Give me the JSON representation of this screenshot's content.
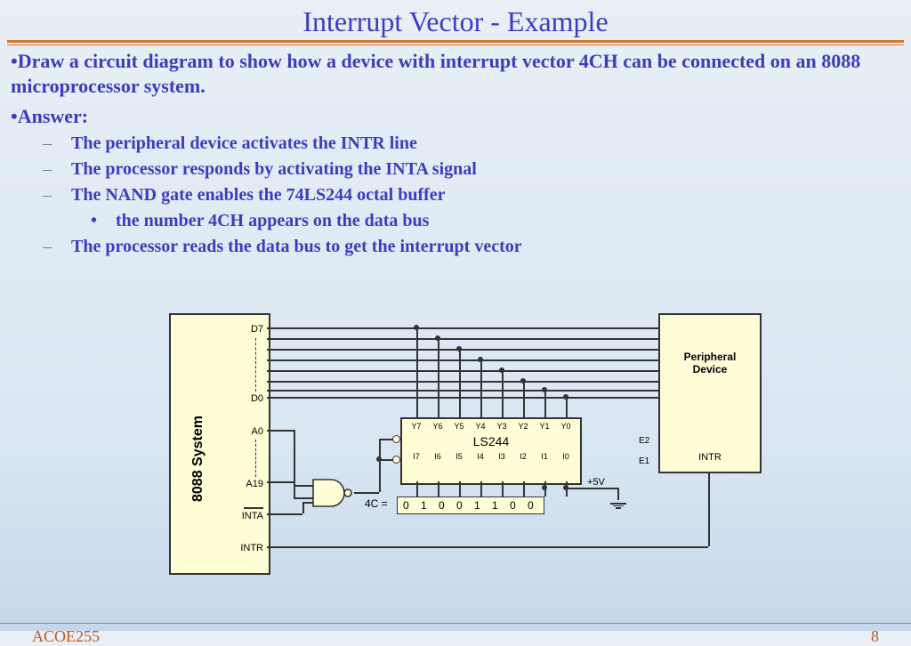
{
  "title": "Interrupt Vector - Example",
  "question": "Draw a circuit diagram to show how a device with interrupt vector 4CH can be connected on an 8088 microprocessor system.",
  "answer_label": "Answer:",
  "points": [
    "The peripheral device activates the INTR line",
    "The processor responds by activating the INTA signal",
    "The NAND gate enables the 74LS244 octal buffer",
    "The processor reads the data bus to get the interrupt vector"
  ],
  "subpoint": "the number 4CH appears on the data bus",
  "diagram": {
    "system_label": "8088 System",
    "system_pins": {
      "d7": "D7",
      "d0": "D0",
      "a0": "A0",
      "a19": "A19",
      "inta": "INTA",
      "intr": "INTR"
    },
    "peripheral_label_1": "Peripheral",
    "peripheral_label_2": "Device",
    "peripheral_intr": "INTR",
    "buffer_name": "LS244",
    "y_pins": [
      "Y7",
      "Y6",
      "Y5",
      "Y4",
      "Y3",
      "Y2",
      "Y1",
      "Y0"
    ],
    "i_pins": [
      "I7",
      "I6",
      "I5",
      "I4",
      "I3",
      "I2",
      "I1",
      "I0"
    ],
    "enables": {
      "e1": "E1",
      "e2": "E2"
    },
    "binary_label": "4C =",
    "binary_value": "0 1 0 0 1 1 0 0",
    "v5": "+5V"
  },
  "footer": {
    "left": "ACOE255",
    "right": "8"
  }
}
